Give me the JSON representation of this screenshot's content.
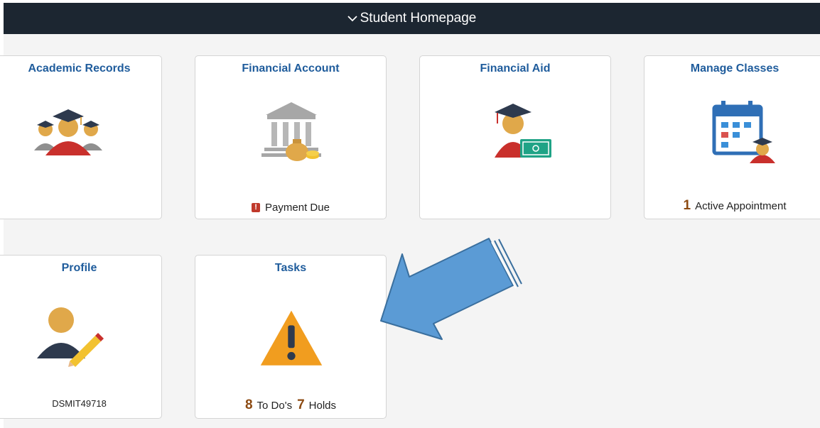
{
  "header": {
    "title": "Student Homepage",
    "chevron_icon": "chevron-down-icon"
  },
  "tiles": {
    "academic_records": {
      "title": "Academic Records",
      "icon": "graduates-group-icon"
    },
    "financial_account": {
      "title": "Financial Account",
      "icon": "bank-moneybag-icon",
      "status": "Payment Due"
    },
    "financial_aid": {
      "title": "Financial Aid",
      "icon": "graduate-money-icon"
    },
    "manage_classes": {
      "title": "Manage Classes",
      "icon": "calendar-graduate-icon",
      "count": "1",
      "status": "Active Appointment"
    },
    "profile": {
      "title": "Profile",
      "icon": "person-pencil-icon",
      "user_id": "DSMIT49718"
    },
    "tasks": {
      "title": "Tasks",
      "icon": "warning-icon",
      "todos_count": "8",
      "todos_label": "To Do's",
      "holds_count": "7",
      "holds_label": "Holds"
    }
  },
  "colors": {
    "topbar": "#1c2631",
    "title": "#1f5c9c",
    "count": "#8c4a12",
    "arrow": "#5b9bd5"
  }
}
